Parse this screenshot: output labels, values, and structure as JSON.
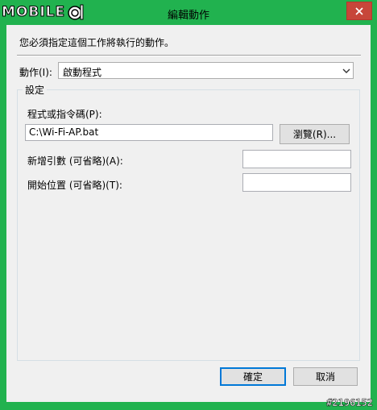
{
  "window": {
    "title": "編輯動作",
    "logo_text": "MOBILE"
  },
  "dialog": {
    "instruction": "您必須指定這個工作將執行的動作。",
    "action_label": "動作(I):",
    "action_value": "啟動程式",
    "settings_group_title": "設定",
    "program_label": "程式或指令碼(P):",
    "program_value": "C:\\Wi-Fi-AP.bat",
    "browse_label": "瀏覽(R)...",
    "args_label": "新增引數 (可省略)(A):",
    "args_value": "",
    "start_in_label": "開始位置 (可省略)(T):",
    "start_in_value": "",
    "ok_label": "確定",
    "cancel_label": "取消"
  },
  "watermark": "#2196152",
  "icons": {
    "close": "close-icon",
    "dropdown": "chevron-down-icon",
    "logo": "mobile01-logo-icon"
  },
  "colors": {
    "frame": "#21b24f",
    "close_button": "#c7463a",
    "client_bg": "#f0f0f0",
    "default_button_border": "#0078d7"
  }
}
